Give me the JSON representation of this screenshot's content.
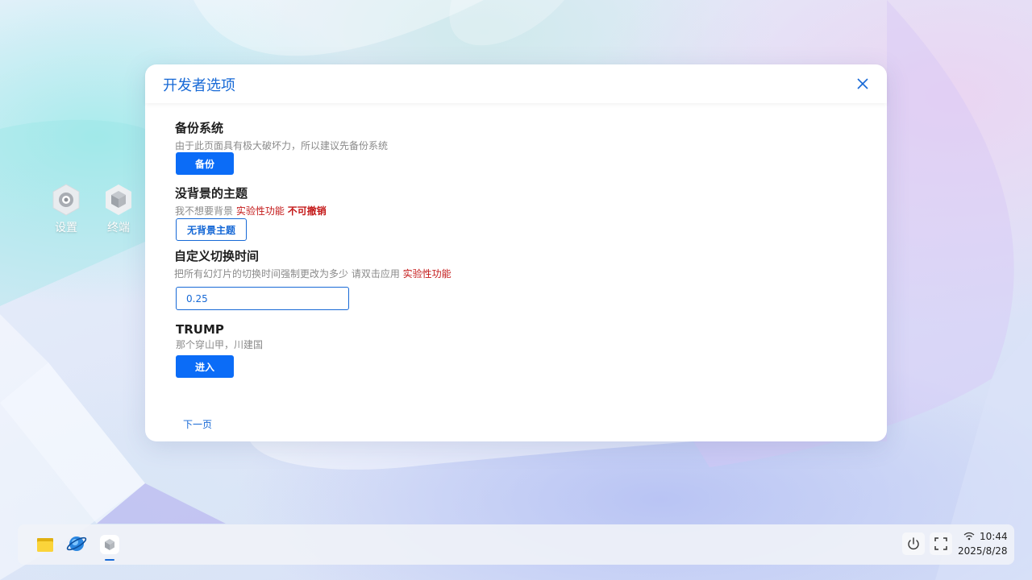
{
  "desktop": {
    "icons": [
      {
        "label": "设置",
        "icon": "gear-icon"
      },
      {
        "label": "终端",
        "icon": "cube-icon"
      }
    ]
  },
  "dialog": {
    "title": "开发者选项",
    "close_icon": "close-icon",
    "sections": {
      "backup": {
        "title": "备份系统",
        "desc": "由于此页面具有极大破坏力，所以建议先备份系统",
        "button": "备份"
      },
      "no_bg": {
        "title": "没背景的主题",
        "desc": "我不想要背景",
        "tag_experimental": "实验性功能",
        "tag_irreversible": "不可撤销",
        "button": "无背景主题"
      },
      "switch_time": {
        "title": "自定义切换时间",
        "desc": "把所有幻灯片的切换时间强制更改为多少 请双击应用",
        "tag_experimental": "实验性功能",
        "value": "0.25"
      },
      "trump": {
        "title": "TRUMP",
        "desc": "那个穿山甲，川建国",
        "button": "进入"
      }
    },
    "next_page": "下一页"
  },
  "taskbar": {
    "apps": [
      "folder-icon",
      "browser-icon",
      "cube-icon"
    ],
    "power_icon": "power-icon",
    "fullscreen_icon": "fullscreen-icon",
    "wifi_icon": "wifi-icon",
    "time": "10:44",
    "date": "2025/8/28"
  },
  "colors": {
    "accent": "#1769d6",
    "primary_button": "#0b6cf7",
    "warning": "#c41a1a"
  }
}
